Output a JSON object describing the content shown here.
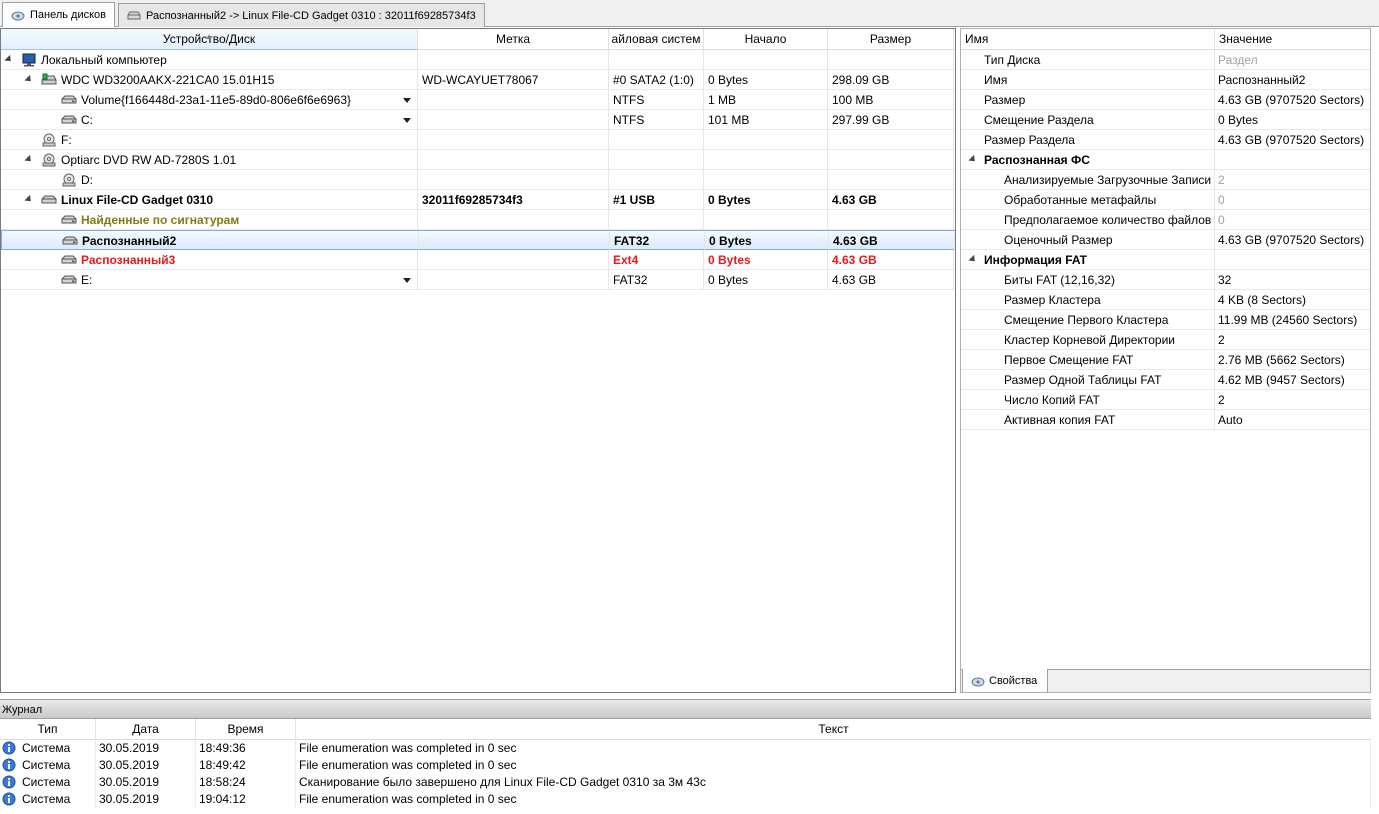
{
  "tabs": [
    {
      "label": "Панель дисков",
      "active": true
    },
    {
      "label": "Распознанный2 -> Linux File-CD Gadget 0310 : 32011f69285734f3",
      "active": false
    }
  ],
  "disk_table": {
    "columns": [
      "Устройство/Диск",
      "Метка",
      "айловая систем",
      "Начало",
      "Размер"
    ],
    "rows": [
      {
        "indent": 0,
        "expand": true,
        "icon": "computer-icon",
        "name": "Локальный компьютер",
        "label": "",
        "fs": "",
        "start": "",
        "size": "",
        "style": ""
      },
      {
        "indent": 1,
        "expand": true,
        "icon": "hdd-green-icon",
        "name": "WDC WD3200AAKX-221CA0 15.01H15",
        "label": "WD-WCAYUET78067",
        "fs": "#0 SATA2 (1:0)",
        "start": "0 Bytes",
        "size": "298.09 GB",
        "style": ""
      },
      {
        "indent": 2,
        "expand": false,
        "icon": "partition-icon",
        "name": "Volume{f166448d-23a1-11e5-89d0-806e6f6e6963}",
        "label": "",
        "fs": "NTFS",
        "start": "1 MB",
        "size": "100 MB",
        "style": "",
        "dropdown": true
      },
      {
        "indent": 2,
        "expand": false,
        "icon": "partition-icon",
        "name": "C:",
        "label": "",
        "fs": "NTFS",
        "start": "101 MB",
        "size": "297.99 GB",
        "style": "",
        "dropdown": true
      },
      {
        "indent": 1,
        "expand": false,
        "icon": "optical-disc-icon",
        "name": "F:",
        "label": "",
        "fs": "",
        "start": "",
        "size": "",
        "style": ""
      },
      {
        "indent": 1,
        "expand": true,
        "icon": "optical-drive-icon",
        "name": "Optiarc DVD RW AD-7280S 1.01",
        "label": "",
        "fs": "",
        "start": "",
        "size": "",
        "style": ""
      },
      {
        "indent": 2,
        "expand": false,
        "icon": "optical-disc-icon",
        "name": "D:",
        "label": "",
        "fs": "",
        "start": "",
        "size": "",
        "style": ""
      },
      {
        "indent": 1,
        "expand": true,
        "icon": "usb-drive-icon",
        "name": "Linux File-CD Gadget 0310",
        "label": "32011f69285734f3",
        "fs": "#1 USB",
        "start": "0 Bytes",
        "size": "4.63 GB",
        "style": "bold"
      },
      {
        "indent": 2,
        "expand": false,
        "icon": "partition-icon",
        "name": "Найденные по сигнатурам",
        "label": "",
        "fs": "",
        "start": "",
        "size": "",
        "style": "bold olive"
      },
      {
        "indent": 2,
        "expand": false,
        "icon": "partition-icon",
        "name": "Распознанный2",
        "label": "",
        "fs": "FAT32",
        "start": "0 Bytes",
        "size": "4.63 GB",
        "style": "bold selected"
      },
      {
        "indent": 2,
        "expand": false,
        "icon": "partition-icon",
        "name": "Распознанный3",
        "label": "",
        "fs": "Ext4",
        "start": "0 Bytes",
        "size": "4.63 GB",
        "style": "bold red"
      },
      {
        "indent": 2,
        "expand": false,
        "icon": "partition-icon",
        "name": "E:",
        "label": "",
        "fs": "FAT32",
        "start": "0 Bytes",
        "size": "4.63 GB",
        "style": "",
        "dropdown": true
      }
    ]
  },
  "properties": {
    "columns": [
      "Имя",
      "Значение"
    ],
    "rows": [
      {
        "indent": 1,
        "group": false,
        "name": "Тип Диска",
        "value": "Раздел",
        "muted": true
      },
      {
        "indent": 1,
        "group": false,
        "name": "Имя",
        "value": "Распознанный2"
      },
      {
        "indent": 1,
        "group": false,
        "name": "Размер",
        "value": "4.63 GB (9707520 Sectors)"
      },
      {
        "indent": 1,
        "group": false,
        "name": "Смещение Раздела",
        "value": "0 Bytes"
      },
      {
        "indent": 1,
        "group": false,
        "name": "Размер Раздела",
        "value": "4.63 GB (9707520 Sectors)"
      },
      {
        "indent": 0,
        "group": true,
        "name": "Распознанная ФС",
        "value": ""
      },
      {
        "indent": 2,
        "group": false,
        "name": "Анализируемые Загрузочные Записи",
        "value": "2",
        "muted": true
      },
      {
        "indent": 2,
        "group": false,
        "name": "Обработанные метафайлы",
        "value": "0",
        "muted": true
      },
      {
        "indent": 2,
        "group": false,
        "name": "Предполагаемое количество файлов",
        "value": "0",
        "muted": true
      },
      {
        "indent": 2,
        "group": false,
        "name": "Оценочный Размер",
        "value": "4.63 GB (9707520 Sectors)"
      },
      {
        "indent": 0,
        "group": true,
        "name": "Информация FAT",
        "value": ""
      },
      {
        "indent": 2,
        "group": false,
        "name": "Биты FAT (12,16,32)",
        "value": "32"
      },
      {
        "indent": 2,
        "group": false,
        "name": "Размер Кластера",
        "value": "4 KB (8 Sectors)"
      },
      {
        "indent": 2,
        "group": false,
        "name": "Смещение Первого Кластера",
        "value": "11.99 MB (24560 Sectors)"
      },
      {
        "indent": 2,
        "group": false,
        "name": "Кластер Корневой Директории",
        "value": "2"
      },
      {
        "indent": 2,
        "group": false,
        "name": "Первое Смещение FAT",
        "value": "2.76 MB (5662 Sectors)"
      },
      {
        "indent": 2,
        "group": false,
        "name": "Размер Одной Таблицы FAT",
        "value": "4.62 MB (9457 Sectors)"
      },
      {
        "indent": 2,
        "group": false,
        "name": "Число Копий FAT",
        "value": "2"
      },
      {
        "indent": 2,
        "group": false,
        "name": "Активная копия FAT",
        "value": "Auto"
      }
    ],
    "tab_label": "Свойства"
  },
  "log": {
    "title": "Журнал",
    "columns": [
      "Тип",
      "Дата",
      "Время",
      "Текст"
    ],
    "rows": [
      {
        "type": "Система",
        "date": "30.05.2019",
        "time": "18:49:36",
        "text": "File enumeration was completed in 0 sec"
      },
      {
        "type": "Система",
        "date": "30.05.2019",
        "time": "18:49:42",
        "text": "File enumeration was completed in 0 sec"
      },
      {
        "type": "Система",
        "date": "30.05.2019",
        "time": "18:58:24",
        "text": "Сканирование было завершено для Linux File-CD Gadget 0310 за 3м 43с"
      },
      {
        "type": "Система",
        "date": "30.05.2019",
        "time": "19:04:12",
        "text": "File enumeration was completed in 0 sec"
      }
    ]
  },
  "colors": {
    "selected_border": "#84acdd",
    "olive_text": "#7d7d13",
    "red_text": "#e31b1b"
  }
}
